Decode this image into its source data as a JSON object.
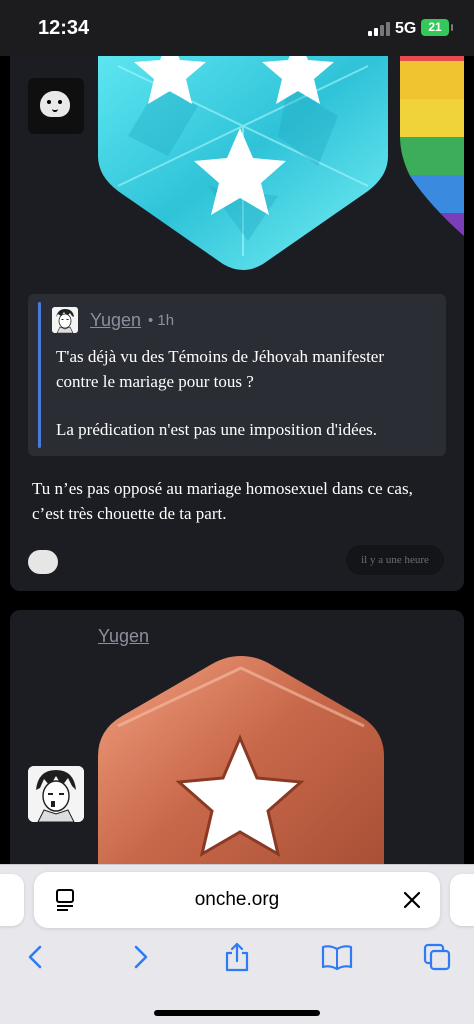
{
  "status_bar": {
    "time": "12:34",
    "network": "5G",
    "battery": "21"
  },
  "post1": {
    "quote": {
      "author": "Yugen",
      "time": "• 1h",
      "paragraphs": [
        "T'as déjà vu des Témoins de Jéhovah manifester contre le mariage pour tous ?",
        "La prédication n'est pas une imposition d'idées."
      ]
    },
    "text": "Tu n’es pas opposé au mariage homosexuel dans ce cas, c’est très chouette de ta part.",
    "timestamp": "il y a une heure"
  },
  "post2": {
    "author": "Yugen"
  },
  "browser": {
    "url": "onche.org"
  },
  "colors": {
    "accent_quote_bar": "#4a7bd8",
    "card_bg": "#1c1d22",
    "badge_cyan": "#3ed8e8",
    "badge_bronze": "#c8684a"
  }
}
